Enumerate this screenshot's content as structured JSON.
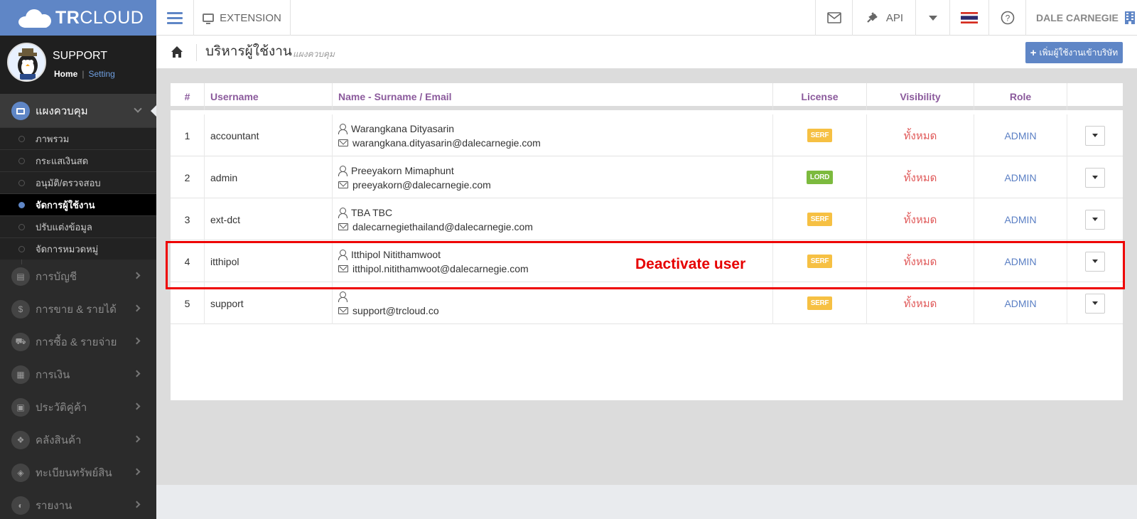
{
  "topbar": {
    "brand_bold": "TR",
    "brand_rest": "CLOUD",
    "extension_label": "EXTENSION",
    "api_label": "API",
    "user_name": "DALE CARNEGIE",
    "icons": {
      "menu": "hamburger-icon",
      "mail": "mail-icon",
      "api": "plug-icon",
      "dropdown": "caret-down-icon",
      "flag": "thai-flag-icon",
      "help": "help-icon",
      "company": "building-icon"
    }
  },
  "sidebar": {
    "profile": {
      "name": "SUPPORT",
      "home_link": "Home",
      "separator": "|",
      "setting_link": "Setting"
    },
    "active_group": {
      "label": "แผงควบคุม",
      "icon": "monitor-icon"
    },
    "subitems": [
      {
        "label": "ภาพรวม",
        "active": false
      },
      {
        "label": "กระแสเงินสด",
        "active": false
      },
      {
        "label": "อนุมัติ/ตรวจสอบ",
        "active": false
      },
      {
        "label": "จัดการผู้ใช้งาน",
        "active": true
      },
      {
        "label": "ปรับแต่งข้อมูล",
        "active": false
      },
      {
        "label": "จัดการหมวดหมู่",
        "active": false
      }
    ],
    "groups": [
      {
        "label": "การบัญชี",
        "icon": "book-icon",
        "glyph": "▤"
      },
      {
        "label": "การขาย & รายได้",
        "icon": "dollar-icon",
        "glyph": "$"
      },
      {
        "label": "การซื้อ & รายจ่าย",
        "icon": "cart-icon",
        "glyph": "⛟"
      },
      {
        "label": "การเงิน",
        "icon": "calendar-icon",
        "glyph": "▦"
      },
      {
        "label": "ประวัติคู่ค้า",
        "icon": "contact-icon",
        "glyph": "▣"
      },
      {
        "label": "คลังสินค้า",
        "icon": "boxes-icon",
        "glyph": "❖"
      },
      {
        "label": "ทะเบียนทรัพย์สิน",
        "icon": "diamond-icon",
        "glyph": "◈"
      },
      {
        "label": "รายงาน",
        "icon": "report-icon",
        "glyph": "◐"
      }
    ]
  },
  "page": {
    "title": "บริหารผู้ใช้งาน",
    "subtitle": "แผงควบคุม",
    "add_button": "เพิ่มผู้ใช้งานเข้าบริษัท",
    "add_button_icon": "+"
  },
  "table": {
    "headers": [
      "#",
      "Username",
      "Name - Surname / Email",
      "License",
      "Visibility",
      "Role"
    ],
    "rows": [
      {
        "num": "1",
        "username": "accountant",
        "name": "Warangkana Dityasarin",
        "email": "warangkana.dityasarin@dalecarnegie.com",
        "license": "SERF",
        "visibility": "ทั้งหมด",
        "role": "ADMIN"
      },
      {
        "num": "2",
        "username": "admin",
        "name": "Preeyakorn Mimaphunt",
        "email": "preeyakorn@dalecarnegie.com",
        "license": "LORD",
        "visibility": "ทั้งหมด",
        "role": "ADMIN"
      },
      {
        "num": "3",
        "username": "ext-dct",
        "name": "TBA TBC",
        "email": "dalecarnegiethailand@dalecarnegie.com",
        "license": "SERF",
        "visibility": "ทั้งหมด",
        "role": "ADMIN"
      },
      {
        "num": "4",
        "username": "itthipol",
        "name": "Itthipol Nitithamwoot",
        "email": "itthipol.nitithamwoot@dalecarnegie.com",
        "license": "SERF",
        "visibility": "ทั้งหมด",
        "role": "ADMIN"
      },
      {
        "num": "5",
        "username": "support",
        "name": "",
        "email": "support@trcloud.co",
        "license": "SERF",
        "visibility": "ทั้งหมด",
        "role": "ADMIN"
      }
    ]
  },
  "annotation": {
    "label": "Deactivate user",
    "color": "#e60000"
  },
  "colors": {
    "brand": "#5f86c6",
    "header_text": "#8b5a9c",
    "visibility": "#e05a5a",
    "role": "#5a7fc4",
    "serf": "#f6c043",
    "lord": "#7cba3e"
  }
}
